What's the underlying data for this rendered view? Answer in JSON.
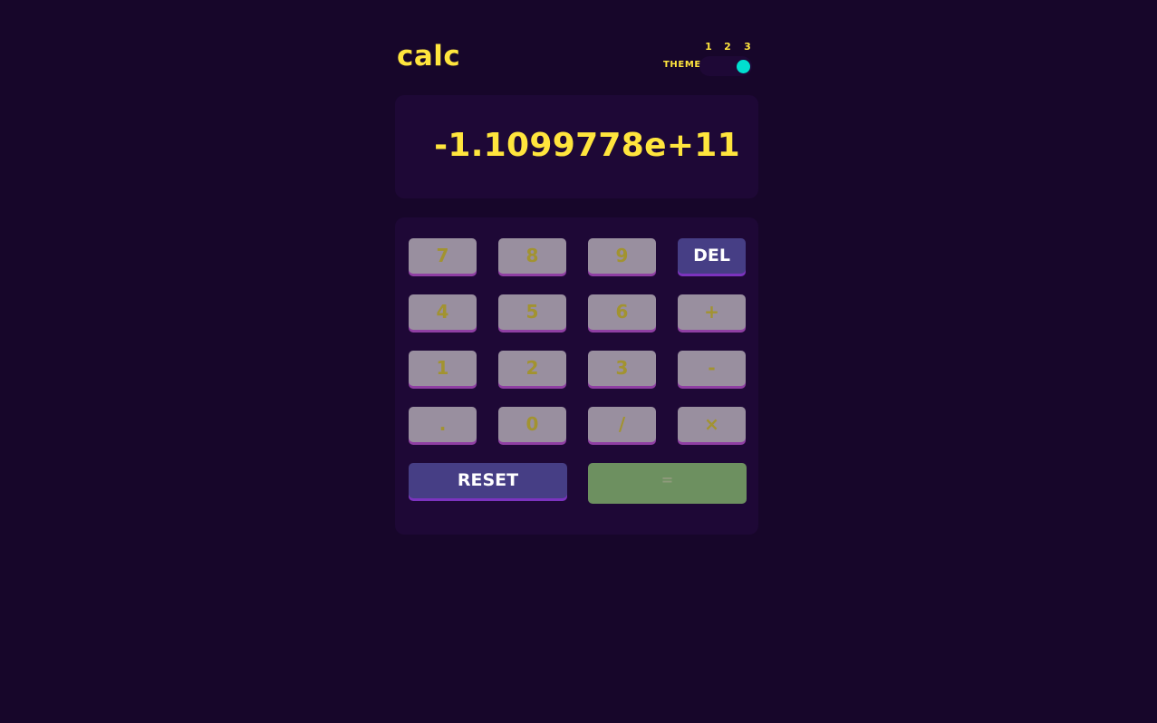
{
  "header": {
    "logo": "calc",
    "theme_label": "THEME",
    "theme_numbers": [
      "1",
      "2",
      "3"
    ],
    "active_theme": 3
  },
  "display": {
    "value": "-1.1099778e+11"
  },
  "keypad": {
    "keys": [
      "7",
      "8",
      "9",
      "DEL",
      "4",
      "5",
      "6",
      "+",
      "1",
      "2",
      "3",
      "-",
      ".",
      "0",
      "/",
      "×"
    ],
    "reset_label": "RESET",
    "equals_label": "="
  },
  "colors": {
    "background": "#17062a",
    "panel": "#1e0836",
    "accent_text": "#ffe53d",
    "toggle_knob": "#00dfd0",
    "function_key": "#463e85",
    "equals_key": "#6d9060"
  }
}
